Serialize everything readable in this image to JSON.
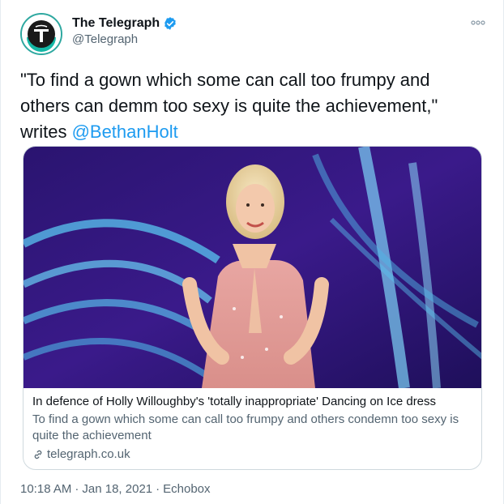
{
  "account": {
    "display_name": "The Telegraph",
    "handle": "@Telegraph",
    "verified": true,
    "avatar_icon": "telegraph-logo-icon"
  },
  "tweet": {
    "text_before_mention": "\"To find a gown which some can call too frumpy and others can demm too sexy is quite the achievement,\" writes ",
    "mention": "@BethanHolt"
  },
  "card": {
    "image_alt_icon": "article-photo",
    "title": "In defence of Holly Willoughby's 'totally inappropriate' Dancing on Ice dress",
    "description": "To find a gown which some can call too frumpy and others condemn too sexy is quite the achievement",
    "domain": "telegraph.co.uk",
    "domain_icon": "link-icon"
  },
  "meta": {
    "time": "10:18 AM",
    "separator_1": "·",
    "date": "Jan 18, 2021",
    "separator_2": "·",
    "source": "Echobox"
  },
  "colors": {
    "link": "#1d9bf0",
    "secondary_text": "#536471",
    "border": "#cfd9de"
  }
}
